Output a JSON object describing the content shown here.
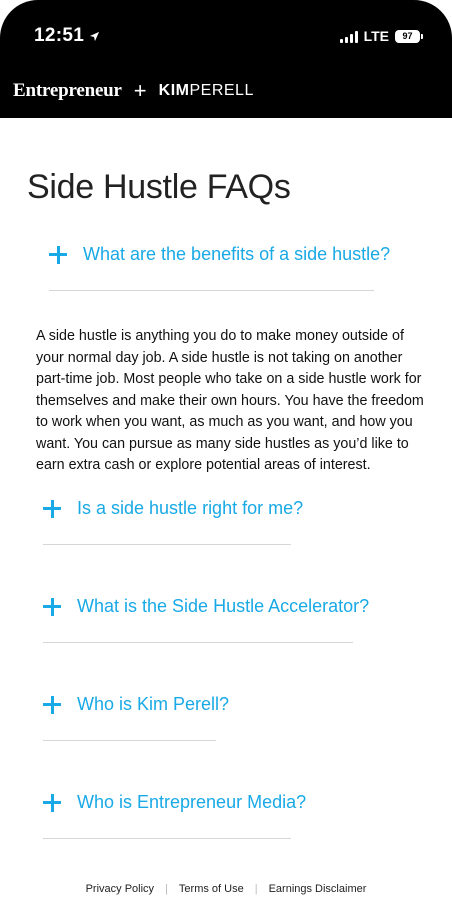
{
  "status_bar": {
    "time": "12:51",
    "network": "LTE",
    "battery": "97"
  },
  "brand": {
    "entrepreneur": "Entrepreneur",
    "plus": "+",
    "kim": "KIM",
    "perell": "PERELL"
  },
  "page": {
    "title": "Side Hustle FAQs"
  },
  "faqs": [
    {
      "question": "What are the benefits of a side hustle?",
      "answer": "A side hustle is anything you do to make money outside of your normal day job. A side hustle is not taking on another part-time job. Most people who take on a side hustle work for themselves and make their own hours. You have the freedom to work when you want, as much as you want, and how you want. You can pursue as many side hustles as you’d like to earn extra cash or explore potential areas of interest."
    },
    {
      "question": "Is a side hustle right for me?"
    },
    {
      "question": "What is the Side Hustle Accelerator?"
    },
    {
      "question": "Who is Kim Perell?"
    },
    {
      "question": "Who is Entrepreneur Media?"
    }
  ],
  "footer": {
    "links": [
      "Privacy Policy",
      "Terms of Use",
      "Earnings Disclaimer"
    ],
    "separator": "|"
  },
  "colors": {
    "accent": "#18a9e6",
    "header_bg": "#000000"
  },
  "icons": {
    "faq_toggle": "plus-icon",
    "location": "location-arrow-icon"
  }
}
